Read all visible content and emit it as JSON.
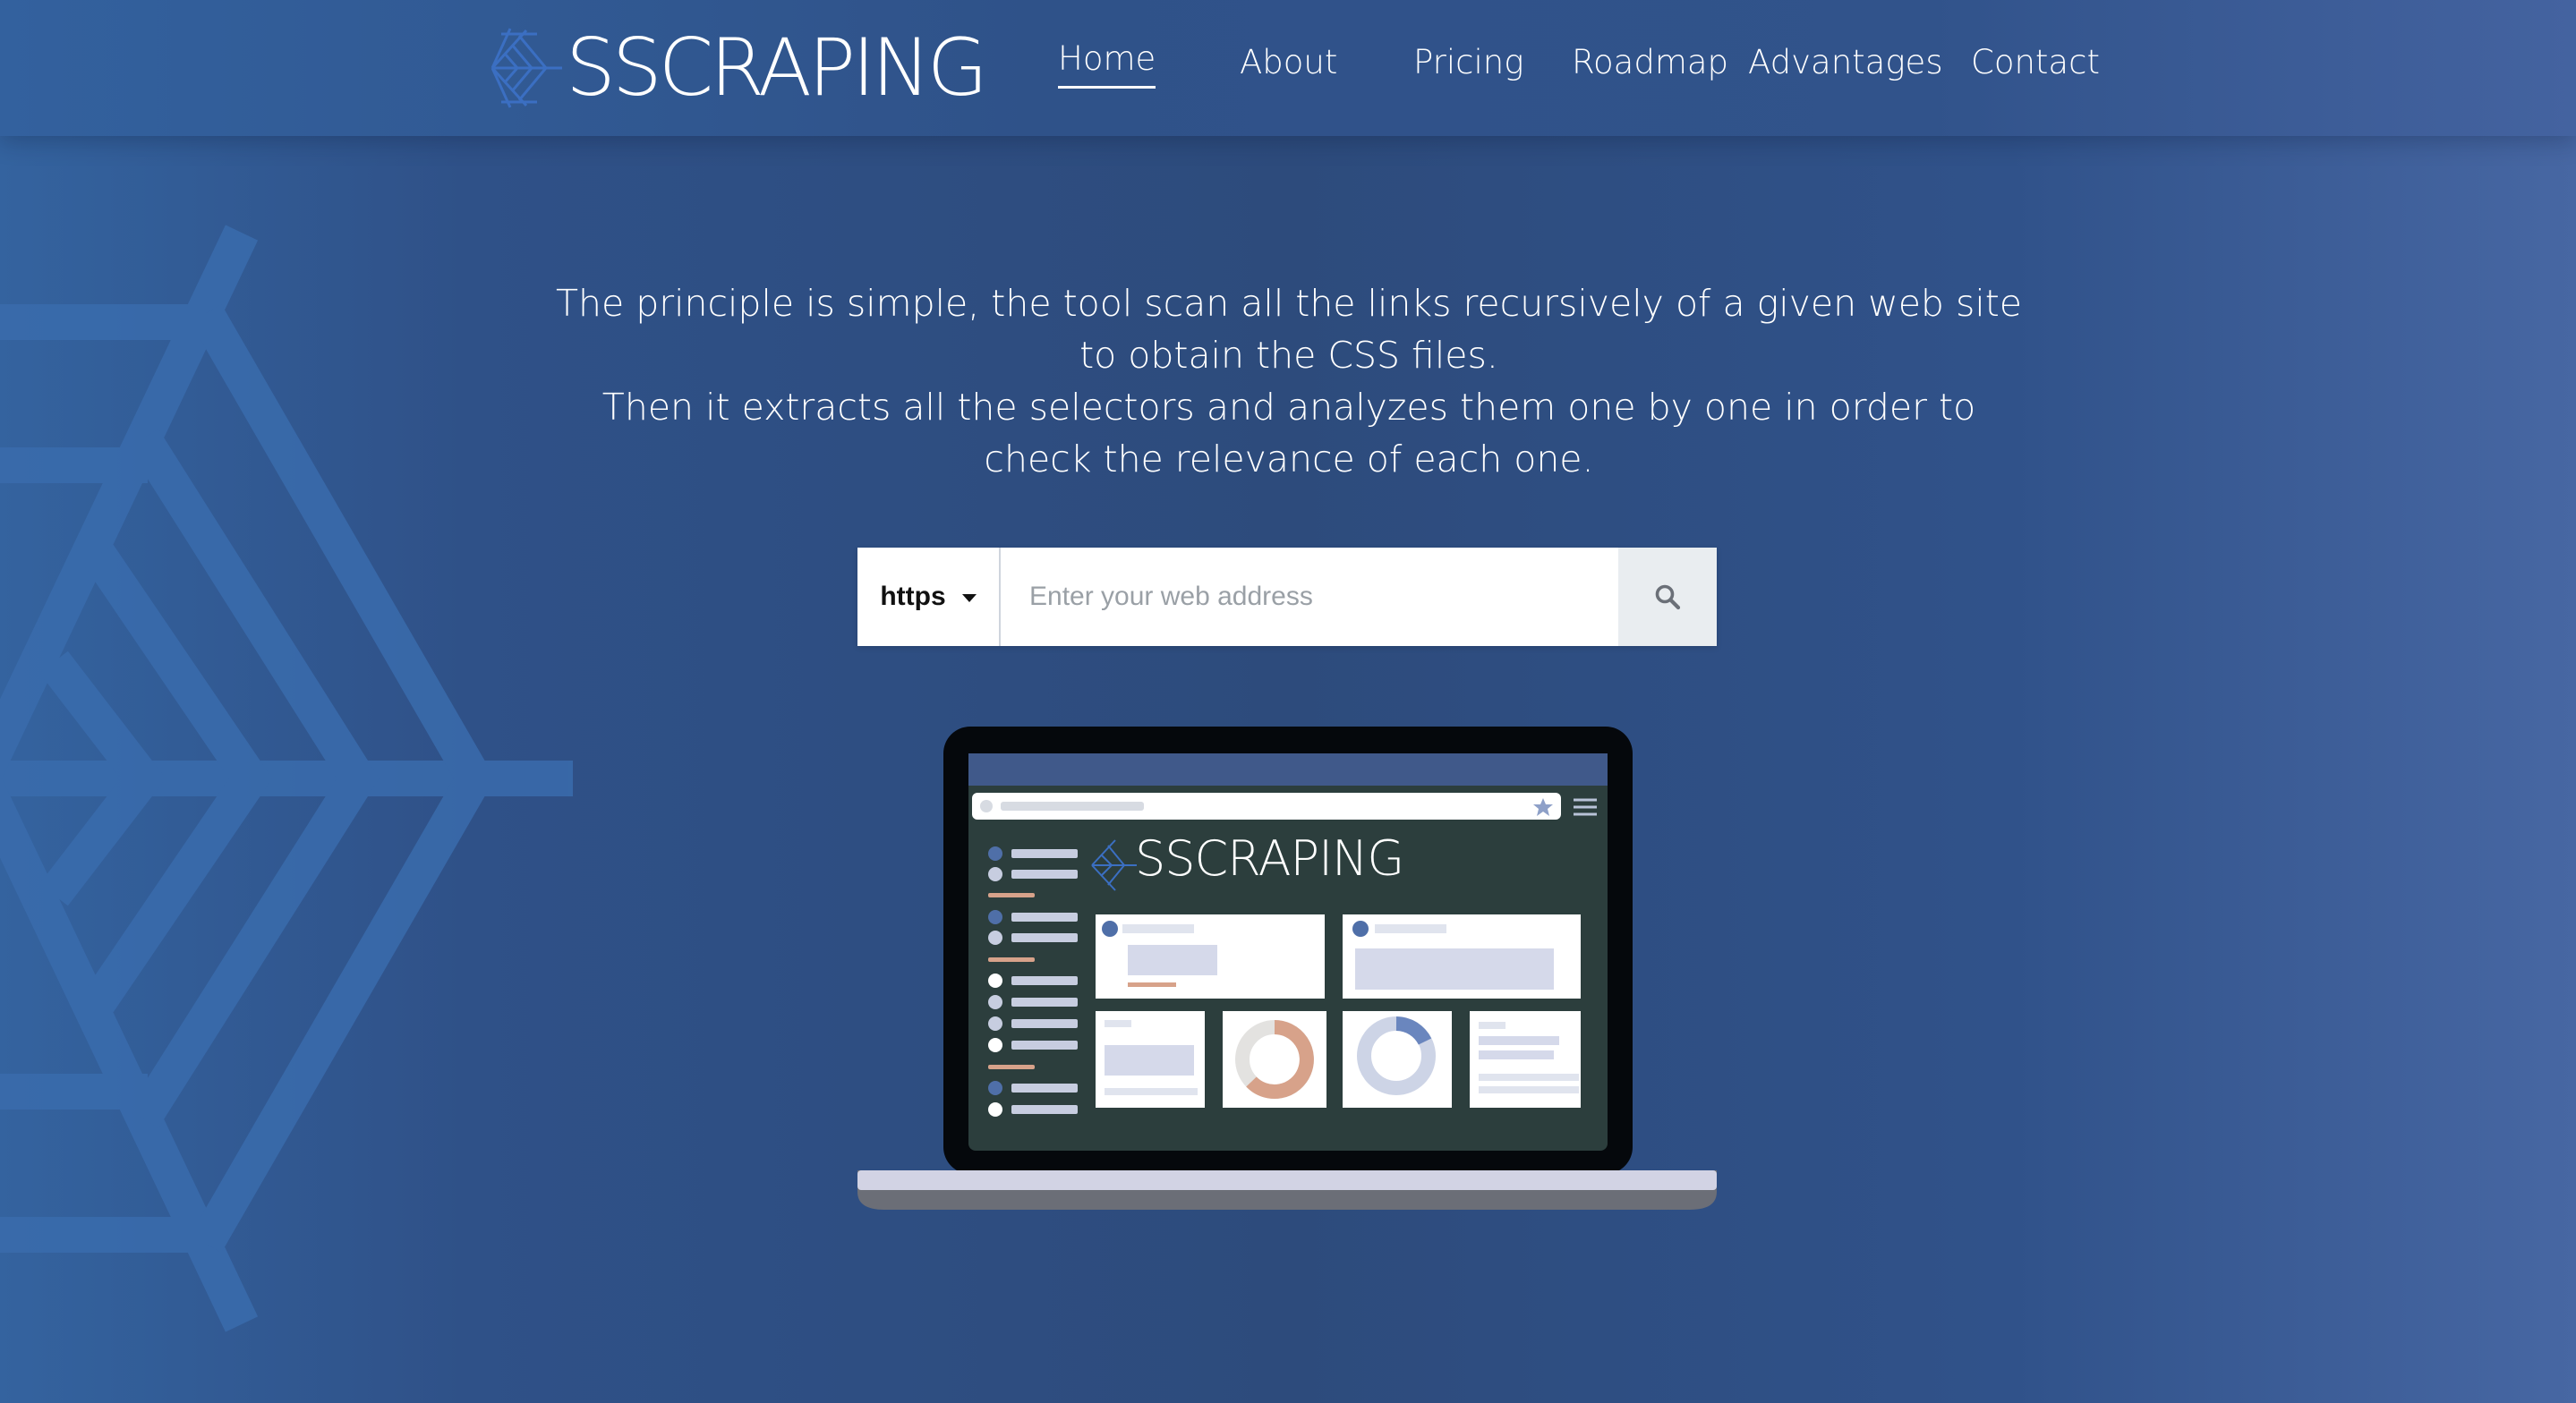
{
  "brand": {
    "name": "SSCRAPING"
  },
  "nav": {
    "items": [
      {
        "label": "Home",
        "active": true
      },
      {
        "label": "About"
      },
      {
        "label": "Pricing"
      },
      {
        "label": "Roadmap"
      },
      {
        "label": "Advantages"
      },
      {
        "label": "Contact"
      }
    ]
  },
  "hero": {
    "line1": "The principle is simple, the tool scan all the links recursively of a given web site to obtain the CSS files.",
    "line2": "Then it extracts all the selectors and analyzes them one by one in order to check the relevance of each one."
  },
  "search": {
    "protocol": "https",
    "placeholder": "Enter your web address"
  },
  "illustration": {
    "screen_logo": "SSCRAPING"
  },
  "colors": {
    "background": "#2d4b7c",
    "web_pattern": "#3a6cad",
    "header": "#31538b",
    "search_button": "#e9edf0",
    "accent_orange": "#d7a28a",
    "accent_blue": "#4f6fa8"
  },
  "icons": {
    "search": "search-icon",
    "logo": "spider-web-icon",
    "dropdown": "caret-down-icon"
  }
}
